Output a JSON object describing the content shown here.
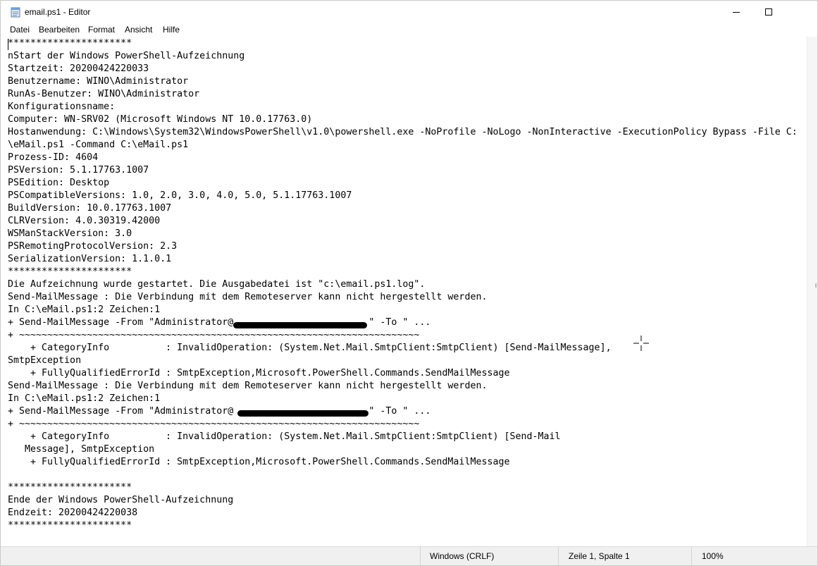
{
  "window": {
    "title": "email.ps1 - Editor"
  },
  "menu": {
    "items": [
      "Datei",
      "Bearbeiten",
      "Format",
      "Ansicht",
      "Hilfe"
    ]
  },
  "editor": {
    "lines": [
      "**********************",
      "nStart der Windows PowerShell-Aufzeichnung",
      "Startzeit: 20200424220033",
      "Benutzername: WINO\\Administrator",
      "RunAs-Benutzer: WINO\\Administrator",
      "Konfigurationsname:",
      "Computer: WN-SRV02 (Microsoft Windows NT 10.0.17763.0)",
      "Hostanwendung: C:\\Windows\\System32\\WindowsPowerShell\\v1.0\\powershell.exe -NoProfile -NoLogo -NonInteractive -ExecutionPolicy Bypass -File C:",
      "\\eMail.ps1 -Command C:\\eMail.ps1",
      "Prozess-ID: 4604",
      "PSVersion: 5.1.17763.1007",
      "PSEdition: Desktop",
      "PSCompatibleVersions: 1.0, 2.0, 3.0, 4.0, 5.0, 5.1.17763.1007",
      "BuildVersion: 10.0.17763.1007",
      "CLRVersion: 4.0.30319.42000",
      "WSManStackVersion: 3.0",
      "PSRemotingProtocolVersion: 2.3",
      "SerializationVersion: 1.1.0.1",
      "**********************",
      "Die Aufzeichnung wurde gestartet. Die Ausgabedatei ist \"c:\\email.ps1.log\".",
      "Send-MailMessage : Die Verbindung mit dem Remoteserver kann nicht hergestellt werden.",
      "In C:\\eMail.ps1:2 Zeichen:1",
      "+ Send-MailMessage -From \"Administrator@                        \" -To \" ...",
      "+ ~~~~~~~~~~~~~~~~~~~~~~~~~~~~~~~~~~~~~~~~~~~~~~~~~~~~~~~~~~~~~~~~~~~~~~~",
      "    + CategoryInfo          : InvalidOperation: (System.Net.Mail.SmtpClient:SmtpClient) [Send-MailMessage],",
      "SmtpException",
      "    + FullyQualifiedErrorId : SmtpException,Microsoft.PowerShell.Commands.SendMailMessage",
      "Send-MailMessage : Die Verbindung mit dem Remoteserver kann nicht hergestellt werden.",
      "In C:\\eMail.ps1:2 Zeichen:1",
      "+ Send-MailMessage -From \"Administrator@                        \" -To \" ...",
      "+ ~~~~~~~~~~~~~~~~~~~~~~~~~~~~~~~~~~~~~~~~~~~~~~~~~~~~~~~~~~~~~~~~~~~~~~~",
      "    + CategoryInfo          : InvalidOperation: (System.Net.Mail.SmtpClient:SmtpClient) [Send-Mail",
      "   Message], SmtpException",
      "    + FullyQualifiedErrorId : SmtpException,Microsoft.PowerShell.Commands.SendMailMessage",
      "",
      "**********************",
      "Ende der Windows PowerShell-Aufzeichnung",
      "Endzeit: 20200424220038",
      "**********************"
    ]
  },
  "status": {
    "encoding": "Windows (CRLF)",
    "position": "Zeile 1, Spalte 1",
    "zoom": "100%"
  }
}
